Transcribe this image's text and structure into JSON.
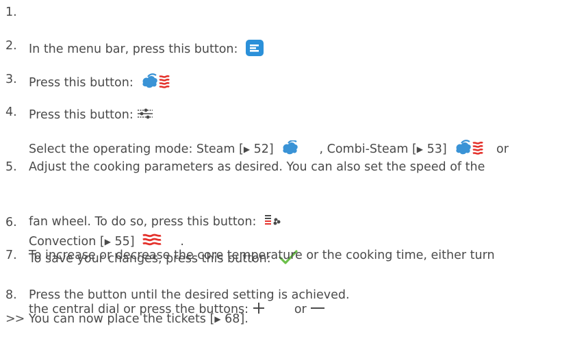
{
  "steps": [
    {
      "num": "1.",
      "text": "In the menu bar, press this button: ",
      "icon": "menu-bar-button-icon"
    },
    {
      "num": "2.",
      "text": "Press this button: ",
      "icon": "combi-steam-mode-icon"
    },
    {
      "num": "3.",
      "text": "Press this button:",
      "icon": "settings-sliders-icon"
    },
    {
      "num": "4.",
      "line1_a": "Select the operating mode: Steam [",
      "ref_arrow": "▶",
      "line1_b": " 52] ",
      "line1_c": ", Combi-Steam [",
      "line1_d": " 53] ",
      "line1_e": " or",
      "line2_a": "Convection [",
      "line2_b": " 55] ",
      "line2_c": "."
    },
    {
      "num": "5.",
      "line1": "Adjust the cooking parameters as desired. You can also set the speed of the",
      "line2": "fan wheel. To do so, press this button: ",
      "icon": "fan-speed-icon"
    },
    {
      "num": "6.",
      "text": "To save your changes, press this button: ",
      "icon": "checkmark-icon"
    },
    {
      "num": "7.",
      "line1": "To increase or decrease the core temperature or the cooking time, either turn",
      "line2_a": "the central dial or press the buttons: ",
      "line2_b": " or ",
      "icon_plus": "plus-icon",
      "icon_minus": "minus-icon"
    },
    {
      "num": "8.",
      "text": "Press the button until the desired setting is achieved."
    }
  ],
  "result": {
    "marker": ">>",
    "text_a": "You can now place the tickets [",
    "ref_arrow": "▶",
    "text_b": " 68]."
  },
  "colors": {
    "text": "#4a4a4a",
    "steam_blue": "#3a93d6",
    "menu_blue": "#2b90d9",
    "convection_red": "#e4312b",
    "check_green": "#6cc04a"
  }
}
